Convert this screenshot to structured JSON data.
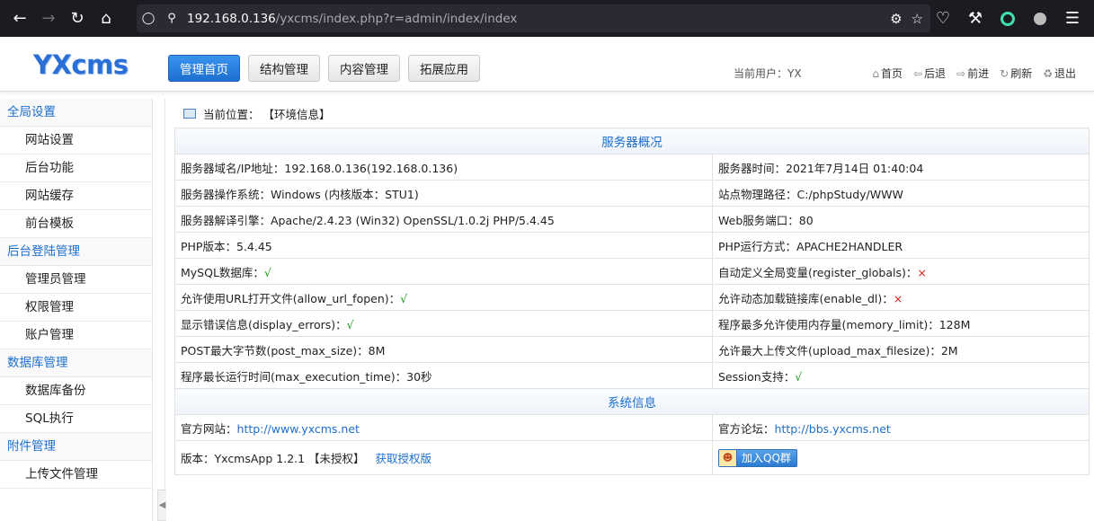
{
  "browser": {
    "url_host": "192.168.0.136",
    "url_path": "/yxcms/index.php?r=admin/index/index"
  },
  "header": {
    "logo": "YXcms",
    "tabs": [
      {
        "label": "管理首页",
        "active": true
      },
      {
        "label": "结构管理",
        "active": false
      },
      {
        "label": "内容管理",
        "active": false
      },
      {
        "label": "拓展应用",
        "active": false
      }
    ],
    "current_user": "当前用户：YX",
    "links": {
      "home": "首页",
      "back": "后退",
      "forward": "前进",
      "refresh": "刷新",
      "logout": "退出"
    }
  },
  "sidebar": {
    "groups": [
      {
        "title": "全局设置",
        "items": [
          "网站设置",
          "后台功能",
          "网站缓存",
          "前台模板"
        ]
      },
      {
        "title": "后台登陆管理",
        "items": [
          "管理员管理",
          "权限管理",
          "账户管理"
        ]
      },
      {
        "title": "数据库管理",
        "items": [
          "数据库备份",
          "SQL执行"
        ]
      },
      {
        "title": "附件管理",
        "items": [
          "上传文件管理"
        ]
      }
    ]
  },
  "breadcrumb": {
    "label": "当前位置：",
    "current": "【环境信息】"
  },
  "server": {
    "title": "服务器概况",
    "rows": [
      [
        "服务器域名/IP地址：192.168.0.136(192.168.0.136)",
        "服务器时间：2021年7月14日 01:40:04"
      ],
      [
        "服务器操作系统：Windows (内核版本：STU1)",
        "站点物理路径：C:/phpStudy/WWW"
      ],
      [
        "服务器解译引擎：Apache/2.4.23 (Win32) OpenSSL/1.0.2j PHP/5.4.45",
        "Web服务端口：80"
      ],
      [
        "PHP版本：5.4.45",
        "PHP运行方式：APACHE2HANDLER"
      ]
    ],
    "flag_rows": [
      {
        "left_label": "MySQL数据库：",
        "left_mark": "√",
        "left_ok": true,
        "right_label": "自动定义全局变量(register_globals)：",
        "right_mark": "×",
        "right_ok": false
      },
      {
        "left_label": "允许使用URL打开文件(allow_url_fopen)：",
        "left_mark": "√",
        "left_ok": true,
        "right_label": "允许动态加载链接库(enable_dl)：",
        "right_mark": "×",
        "right_ok": false
      }
    ],
    "rows2": [
      {
        "left_label": "显示错误信息(display_errors)：",
        "left_mark": "√",
        "right": "程序最多允许使用内存量(memory_limit)：128M"
      },
      {
        "left_label": "POST最大字节数(post_max_size)：8M",
        "left_mark": "",
        "right": "允许最大上传文件(upload_max_filesize)：2M"
      }
    ],
    "last_row": {
      "left": "程序最长运行时间(max_execution_time)：30秒",
      "right_label": "Session支持：",
      "right_mark": "√"
    }
  },
  "system": {
    "title": "系统信息",
    "site_label": "官方网站：",
    "site_url": "http://www.yxcms.net",
    "forum_label": "官方论坛：",
    "forum_url": "http://bbs.yxcms.net",
    "version_label": "版本：YxcmsApp 1.2.1 【未授权】",
    "license_link": "获取授权版",
    "qq_button": "加入QQ群"
  },
  "colors": {
    "accent": "#1d6fcf",
    "ok": "#1a9a1a",
    "bad": "#e02020"
  }
}
